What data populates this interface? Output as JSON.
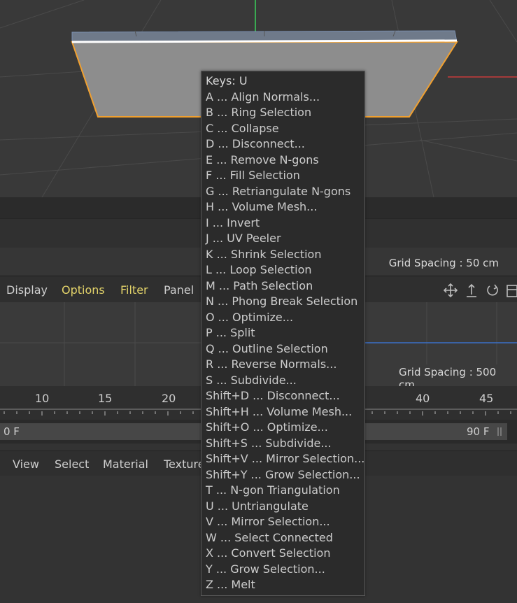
{
  "viewport_top": {
    "grid_spacing": "Grid Spacing : 50 cm"
  },
  "viewport_bottom": {
    "menu": [
      "Display",
      "Options",
      "Filter",
      "Panel"
    ],
    "grid_spacing": "Grid Spacing : 500 cm"
  },
  "timeline": {
    "ticks": [
      "10",
      "15",
      "20",
      "40",
      "45"
    ],
    "start_frame": "0 F",
    "end_frame": "90 F"
  },
  "material_menu": [
    "View",
    "Select",
    "Material",
    "Texture"
  ],
  "colors": {
    "accent_yellow": "#e3d36a",
    "selection_orange": "#f0a030",
    "axis_green": "#3bd05a",
    "axis_red": "#c83a3a",
    "axis_blue": "#3a6fc8"
  },
  "popup": {
    "title": "Keys: U",
    "items": [
      "A ... Align Normals...",
      "B ... Ring Selection",
      "C ... Collapse",
      "D ... Disconnect...",
      "E ... Remove N-gons",
      "F ... Fill Selection",
      "G ... Retriangulate N-gons",
      "H ... Volume Mesh...",
      "I ... Invert",
      "J ... UV Peeler",
      "K ... Shrink Selection",
      "L ... Loop Selection",
      "M ... Path Selection",
      "N ... Phong Break Selection",
      "O ... Optimize...",
      "P ... Split",
      "Q ... Outline Selection",
      "R ... Reverse Normals...",
      "S ... Subdivide...",
      "Shift+D ... Disconnect...",
      "Shift+H ... Volume Mesh...",
      "Shift+O ... Optimize...",
      "Shift+S ... Subdivide...",
      "Shift+V ... Mirror Selection...",
      "Shift+Y ... Grow Selection...",
      "T ... N-gon Triangulation",
      "U ... Untriangulate",
      "V ... Mirror Selection...",
      "W ... Select Connected",
      "X ... Convert Selection",
      "Y ... Grow Selection...",
      "Z ... Melt"
    ]
  }
}
